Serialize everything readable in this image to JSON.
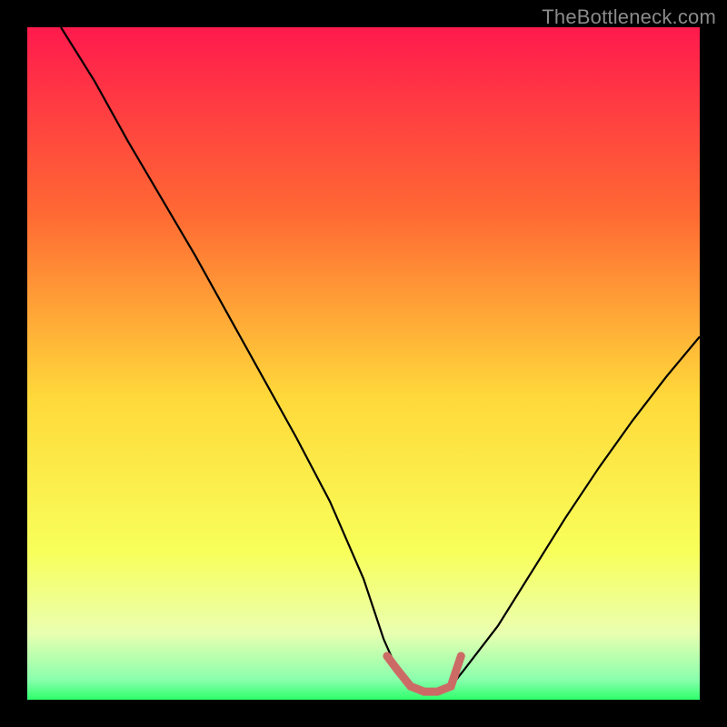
{
  "watermark": "TheBottleneck.com",
  "colors": {
    "black": "#000000",
    "curve": "#000000",
    "salmon": "#cc6b66",
    "grad_top": "#ff1a4d",
    "grad_mid_top": "#ff8a2a",
    "grad_mid": "#ffe93a",
    "grad_low": "#f2ff80",
    "grad_green": "#2eff6a"
  },
  "chart_data": {
    "type": "line",
    "title": "",
    "xlabel": "",
    "ylabel": "",
    "xlim": [
      0,
      100
    ],
    "ylim": [
      0,
      100
    ],
    "x": [
      5,
      10,
      15,
      20,
      25,
      30,
      35,
      40,
      45,
      50,
      53,
      55,
      57,
      59,
      61,
      63,
      65,
      70,
      75,
      80,
      85,
      90,
      95,
      100
    ],
    "values": [
      100,
      92,
      83,
      74.5,
      66,
      57,
      48,
      39,
      29.5,
      18,
      9,
      4.5,
      2,
      1.2,
      1.2,
      2,
      4.5,
      11,
      19,
      27,
      34.5,
      41.5,
      48,
      54
    ],
    "annotations": [
      {
        "text": "salmon flat segment at valley bottom",
        "x_range": [
          53.5,
          64.5
        ],
        "y": 1.5
      }
    ]
  }
}
